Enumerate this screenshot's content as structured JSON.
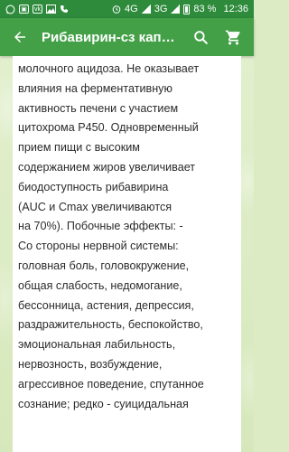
{
  "status_bar": {
    "network_4g": "4G",
    "network_3g": "3G",
    "battery_percent": "83 %",
    "time": "12:36"
  },
  "app_bar": {
    "title": "Рибавирин-сз кап…",
    "icons": [
      "back-arrow-icon",
      "search-icon",
      "cart-icon"
    ]
  },
  "article": {
    "lines": [
      "молочного ацидоза. Не оказывает",
      "влияния на ферментативную",
      "активность печени с участием",
      "цитохрома P450. Одновременный",
      "прием пищи с высоким",
      "содержанием жиров увеличивает",
      "биодоступность рибавирина",
      "(AUC и Cmax увеличиваются",
      "на 70%). Побочные эффекты: -",
      "Со стороны нервной системы:",
      "головная боль, головокружение,",
      "общая слабость, недомогание,",
      "бессонница, астения, депрессия,",
      "раздражительность, беспокойство,",
      "эмоциональная лабильность,",
      "нервозность, возбуждение,",
      "агрессивное поведение, спутанное",
      "сознание; редко - суицидальная"
    ]
  },
  "colors": {
    "status_bar": "#2e8b3c",
    "app_bar": "#43a047",
    "background": "#dcebc4"
  }
}
